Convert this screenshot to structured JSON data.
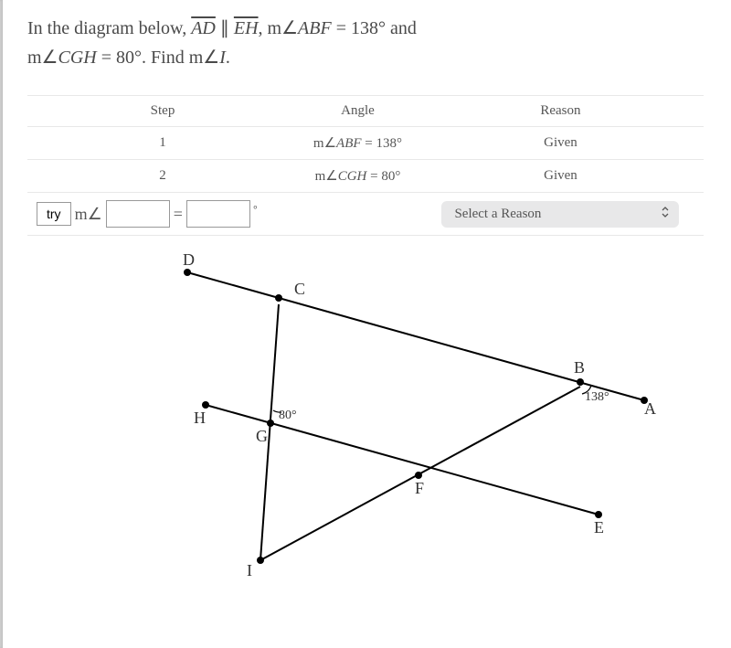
{
  "problem": {
    "prefix": "In the diagram below, ",
    "seg1": "AD",
    "parallel": " ∥ ",
    "seg2": "EH",
    "comma_m": ", m∠",
    "abf": "ABF",
    "eq138": " = 138° and",
    "line2_m": "m∠",
    "cgh": "CGH",
    "eq80": " = 80°. Find m∠",
    "i": "I",
    "period": "."
  },
  "table": {
    "headers": {
      "step": "Step",
      "angle": "Angle",
      "reason": "Reason"
    },
    "rows": [
      {
        "step": "1",
        "angle_prefix": "m∠",
        "angle_name": "ABF",
        "angle_eq": " = 138°",
        "reason": "Given"
      },
      {
        "step": "2",
        "angle_prefix": "m∠",
        "angle_name": "CGH",
        "angle_eq": " = 80°",
        "reason": "Given"
      }
    ],
    "try_row": {
      "try_label": "try",
      "m_angle": "m∠",
      "equals": "=",
      "deg": "∘",
      "reason_placeholder": "Select a Reason"
    }
  },
  "diagram": {
    "labels": {
      "A": "A",
      "B": "B",
      "C": "C",
      "D": "D",
      "E": "E",
      "F": "F",
      "G": "G",
      "H": "H",
      "I": "I"
    },
    "angles": {
      "g": "80°",
      "b": "138°"
    }
  }
}
